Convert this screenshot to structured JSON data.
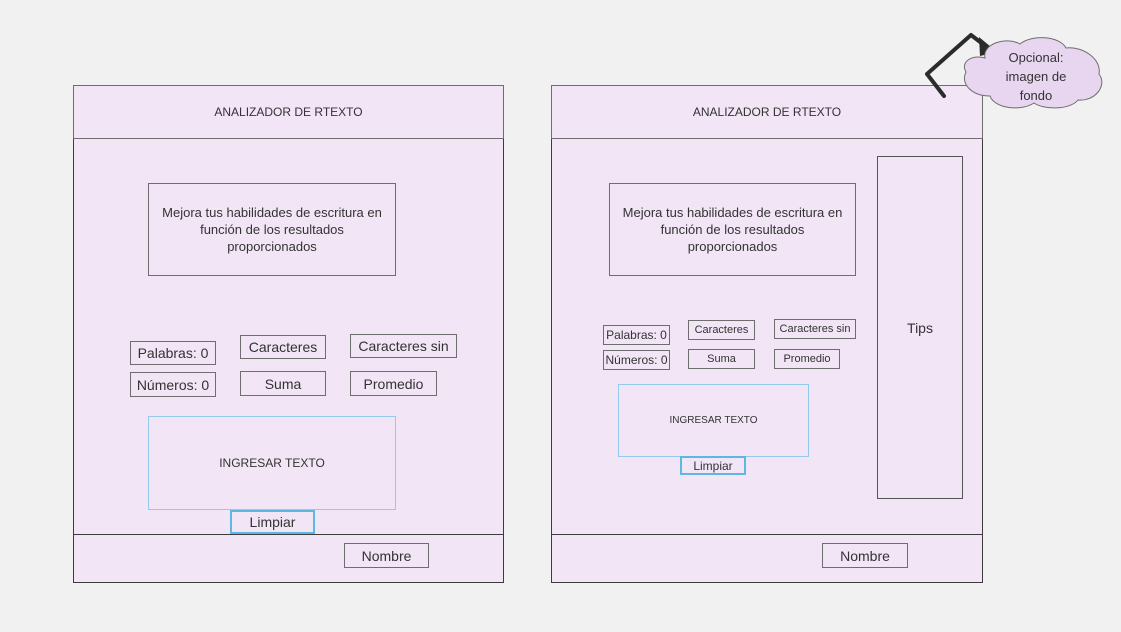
{
  "wireframes": [
    {
      "header_title": "ANALIZADOR DE RTEXTO",
      "description": "Mejora tus habilidades de escritura en función de los resultados proporcionados",
      "stats": {
        "words": "Palabras: 0",
        "characters": "Caracteres",
        "characters_no_spaces": "Caracteres sin",
        "numbers": "Números: 0",
        "sum": "Suma",
        "average": "Promedio"
      },
      "input_label": "INGRESAR TEXTO",
      "clear_label": "Limpiar",
      "footer_name": "Nombre"
    },
    {
      "header_title": "ANALIZADOR DE RTEXTO",
      "description": "Mejora tus habilidades de escritura en función de los resultados proporcionados",
      "stats": {
        "words": "Palabras: 0",
        "characters": "Caracteres",
        "characters_no_spaces": "Caracteres sin",
        "numbers": "Números: 0",
        "sum": "Suma",
        "average": "Promedio"
      },
      "input_label": "INGRESAR TEXTO",
      "clear_label": "Limpiar",
      "footer_name": "Nombre",
      "tips_label": "Tips"
    }
  ],
  "annotation": {
    "note": "Opcional: imagen de fondo",
    "cloud_color": "#e8d5f0",
    "arrow_color": "#2b2b2b"
  }
}
